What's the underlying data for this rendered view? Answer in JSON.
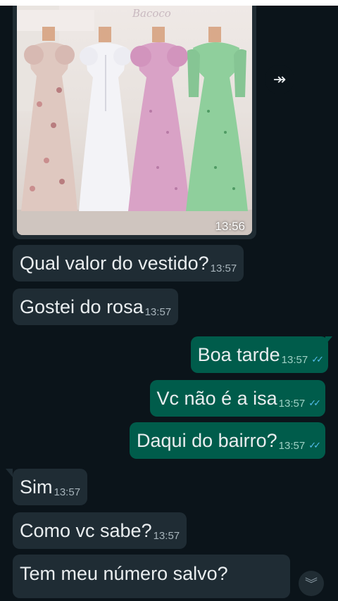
{
  "photo_message": {
    "sign_text": "Bacoco",
    "time": "13:56"
  },
  "icons": {
    "forward": "forward-icon",
    "read_receipt": "double-check-icon",
    "scroll_down": "chevron-double-down-icon"
  },
  "colors": {
    "background": "#0b141a",
    "incoming_bubble": "#1f2c34",
    "outgoing_bubble": "#005c4b",
    "read_check": "#53bdeb"
  },
  "messages": [
    {
      "direction": "incoming",
      "text": "Qual valor do vestido?",
      "time": "13:57"
    },
    {
      "direction": "incoming",
      "text": "Gostei do rosa",
      "time": "13:57"
    },
    {
      "direction": "outgoing",
      "text": "Boa tarde",
      "time": "13:57",
      "status": "read"
    },
    {
      "direction": "outgoing",
      "text": "Vc não é a isa",
      "time": "13:57",
      "status": "read"
    },
    {
      "direction": "outgoing",
      "text": "Daqui do bairro?",
      "time": "13:57",
      "status": "read"
    },
    {
      "direction": "incoming",
      "text": "Sim",
      "time": "13:57"
    },
    {
      "direction": "incoming",
      "text": "Como vc sabe?",
      "time": "13:57"
    },
    {
      "direction": "incoming",
      "text": "Tem meu número salvo?",
      "time": ""
    }
  ]
}
